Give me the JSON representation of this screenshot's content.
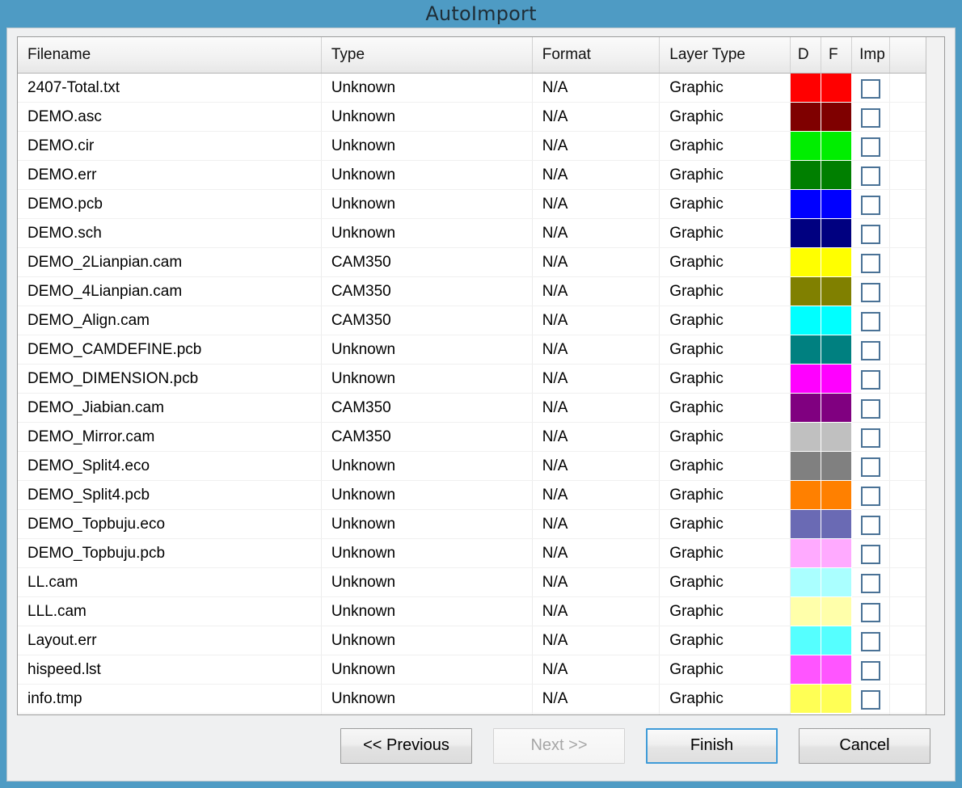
{
  "window": {
    "title": "AutoImport"
  },
  "table": {
    "columns": [
      {
        "key": "filename",
        "label": "Filename"
      },
      {
        "key": "type",
        "label": "Type"
      },
      {
        "key": "format",
        "label": "Format"
      },
      {
        "key": "layer_type",
        "label": "Layer Type"
      },
      {
        "key": "d",
        "label": "D"
      },
      {
        "key": "f",
        "label": "F"
      },
      {
        "key": "imp",
        "label": "Imp"
      }
    ],
    "rows": [
      {
        "filename": "2407-Total.txt",
        "type": "Unknown",
        "format": "N/A",
        "layer_type": "Graphic",
        "d_color": "#FF0000",
        "f_color": "#FF0000",
        "imp": false
      },
      {
        "filename": "DEMO.asc",
        "type": "Unknown",
        "format": "N/A",
        "layer_type": "Graphic",
        "d_color": "#7F0000",
        "f_color": "#7F0000",
        "imp": false
      },
      {
        "filename": "DEMO.cir",
        "type": "Unknown",
        "format": "N/A",
        "layer_type": "Graphic",
        "d_color": "#00EE00",
        "f_color": "#00EE00",
        "imp": false
      },
      {
        "filename": "DEMO.err",
        "type": "Unknown",
        "format": "N/A",
        "layer_type": "Graphic",
        "d_color": "#007F00",
        "f_color": "#007F00",
        "imp": false
      },
      {
        "filename": "DEMO.pcb",
        "type": "Unknown",
        "format": "N/A",
        "layer_type": "Graphic",
        "d_color": "#0000FF",
        "f_color": "#0000FF",
        "imp": false
      },
      {
        "filename": "DEMO.sch",
        "type": "Unknown",
        "format": "N/A",
        "layer_type": "Graphic",
        "d_color": "#000080",
        "f_color": "#000080",
        "imp": false
      },
      {
        "filename": "DEMO_2Lianpian.cam",
        "type": "CAM350",
        "format": "N/A",
        "layer_type": "Graphic",
        "d_color": "#FFFF00",
        "f_color": "#FFFF00",
        "imp": false
      },
      {
        "filename": "DEMO_4Lianpian.cam",
        "type": "CAM350",
        "format": "N/A",
        "layer_type": "Graphic",
        "d_color": "#808000",
        "f_color": "#808000",
        "imp": false
      },
      {
        "filename": "DEMO_Align.cam",
        "type": "CAM350",
        "format": "N/A",
        "layer_type": "Graphic",
        "d_color": "#00FFFF",
        "f_color": "#00FFFF",
        "imp": false
      },
      {
        "filename": "DEMO_CAMDEFINE.pcb",
        "type": "Unknown",
        "format": "N/A",
        "layer_type": "Graphic",
        "d_color": "#008080",
        "f_color": "#008080",
        "imp": false
      },
      {
        "filename": "DEMO_DIMENSION.pcb",
        "type": "Unknown",
        "format": "N/A",
        "layer_type": "Graphic",
        "d_color": "#FF00FF",
        "f_color": "#FF00FF",
        "imp": false
      },
      {
        "filename": "DEMO_Jiabian.cam",
        "type": "CAM350",
        "format": "N/A",
        "layer_type": "Graphic",
        "d_color": "#800080",
        "f_color": "#800080",
        "imp": false
      },
      {
        "filename": "DEMO_Mirror.cam",
        "type": "CAM350",
        "format": "N/A",
        "layer_type": "Graphic",
        "d_color": "#C0C0C0",
        "f_color": "#C0C0C0",
        "imp": false
      },
      {
        "filename": "DEMO_Split4.eco",
        "type": "Unknown",
        "format": "N/A",
        "layer_type": "Graphic",
        "d_color": "#808080",
        "f_color": "#808080",
        "imp": false
      },
      {
        "filename": "DEMO_Split4.pcb",
        "type": "Unknown",
        "format": "N/A",
        "layer_type": "Graphic",
        "d_color": "#FF8000",
        "f_color": "#FF8000",
        "imp": false
      },
      {
        "filename": "DEMO_Topbuju.eco",
        "type": "Unknown",
        "format": "N/A",
        "layer_type": "Graphic",
        "d_color": "#6A6AB4",
        "f_color": "#6A6AB4",
        "imp": false
      },
      {
        "filename": "DEMO_Topbuju.pcb",
        "type": "Unknown",
        "format": "N/A",
        "layer_type": "Graphic",
        "d_color": "#FFAAFF",
        "f_color": "#FFAAFF",
        "imp": false
      },
      {
        "filename": "LL.cam",
        "type": "Unknown",
        "format": "N/A",
        "layer_type": "Graphic",
        "d_color": "#AAFFFF",
        "f_color": "#AAFFFF",
        "imp": false
      },
      {
        "filename": "LLL.cam",
        "type": "Unknown",
        "format": "N/A",
        "layer_type": "Graphic",
        "d_color": "#FFFFAA",
        "f_color": "#FFFFAA",
        "imp": false
      },
      {
        "filename": "Layout.err",
        "type": "Unknown",
        "format": "N/A",
        "layer_type": "Graphic",
        "d_color": "#55FFFF",
        "f_color": "#55FFFF",
        "imp": false
      },
      {
        "filename": "hispeed.lst",
        "type": "Unknown",
        "format": "N/A",
        "layer_type": "Graphic",
        "d_color": "#FF55FF",
        "f_color": "#FF55FF",
        "imp": false
      },
      {
        "filename": "info.tmp",
        "type": "Unknown",
        "format": "N/A",
        "layer_type": "Graphic",
        "d_color": "#FFFF55",
        "f_color": "#FFFF55",
        "imp": false
      }
    ]
  },
  "footer": {
    "previous_label": "<< Previous",
    "next_label": "Next >>",
    "finish_label": "Finish",
    "cancel_label": "Cancel",
    "next_enabled": false,
    "finish_is_default": true
  },
  "colors": {
    "window_chrome": "#4e9bc4",
    "dialog_background": "#eff0f1",
    "focus_border": "#3f9bd8",
    "checkbox_border": "#4a7296"
  }
}
